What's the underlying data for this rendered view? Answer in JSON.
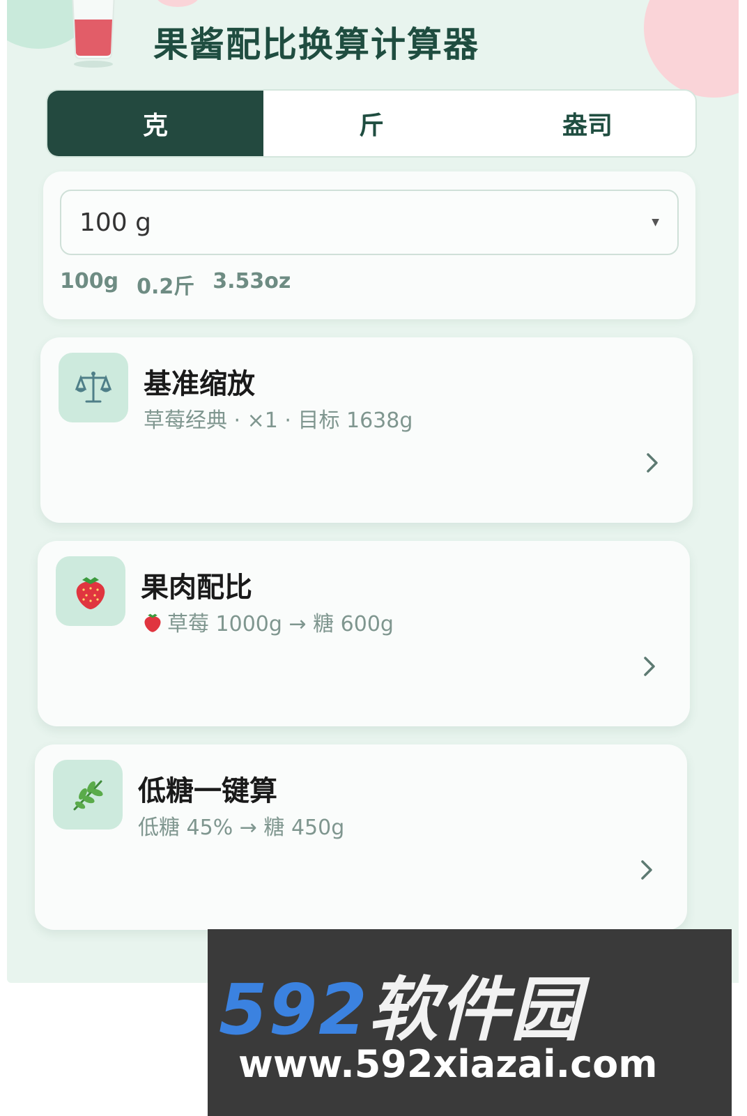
{
  "header": {
    "title": "果酱配比换算计算器"
  },
  "unit_tabs": [
    {
      "label": "克",
      "active": true
    },
    {
      "label": "斤",
      "active": false
    },
    {
      "label": "盎司",
      "active": false
    }
  ],
  "weight": {
    "selected_value": "100 g",
    "conversions": [
      "100g",
      "0.2斤",
      "3.53oz"
    ]
  },
  "features": [
    {
      "icon": "scale-icon",
      "title": "基准缩放",
      "subtitle": "草莓经典 · ×1 · 目标 1638g"
    },
    {
      "icon": "strawberry-icon",
      "title": "果肉配比",
      "subtitle": "草莓 1000g → 糖 600g"
    },
    {
      "icon": "herb-icon",
      "title": "低糖一键算",
      "subtitle": "低糖 45% → 糖 450g"
    }
  ],
  "watermark": {
    "brand_num": "592",
    "brand_cn": "软件园",
    "url": "www.592xiazai.com"
  },
  "colors": {
    "background": "#e8f4ee",
    "accent_dark": "#23493f",
    "title": "#1f4d40",
    "icon_bg": "#cdeadd"
  }
}
